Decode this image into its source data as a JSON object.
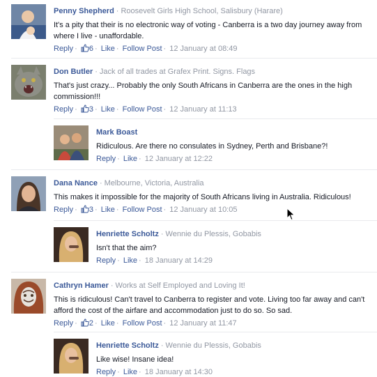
{
  "comments": [
    {
      "author": "Penny Shepherd",
      "headline": "Roosevelt Girls High School, Salisbury (Harare)",
      "text": "It's a pity that their is no electronic way of voting - Canberra is a two day journey away from where I live - unaffordable.",
      "reply_label": "Reply",
      "likes": "6",
      "like_label": "Like",
      "follow_label": "Follow Post",
      "time": "12 January at 08:49"
    },
    {
      "author": "Don Butler",
      "headline": "Jack of all trades at Grafex Print. Signs. Flags",
      "text": "That's just crazy... Probably the only South Africans in Canberra are the ones in the high commission!!!",
      "reply_label": "Reply",
      "likes": "3",
      "like_label": "Like",
      "follow_label": "Follow Post",
      "time": "12 January at 11:13"
    },
    {
      "author": "Mark Boast",
      "text": "Ridiculous. Are there no consulates in Sydney, Perth and Brisbane?!",
      "reply_label": "Reply",
      "like_label": "Like",
      "time": "12 January at 12:22"
    },
    {
      "author": "Dana Nance",
      "headline": "Melbourne, Victoria, Australia",
      "text": "This makes it impossible for the majority of South Africans living in Australia. Ridiculous!",
      "reply_label": "Reply",
      "likes": "3",
      "like_label": "Like",
      "follow_label": "Follow Post",
      "time": "12 January at 10:05"
    },
    {
      "author": "Henriette Scholtz",
      "headline": "Wennie du Plessis, Gobabis",
      "text": "Isn't that the aim?",
      "reply_label": "Reply",
      "like_label": "Like",
      "time": "18 January at 14:29"
    },
    {
      "author": "Cathryn Hamer",
      "headline": "Works at Self Employed and Loving It!",
      "text": "This is ridiculous! Can't travel to Canberra to register and vote. Living too far away and can't afford the cost of the airfare and accommodation just to do so. So sad.",
      "reply_label": "Reply",
      "likes": "2",
      "like_label": "Like",
      "follow_label": "Follow Post",
      "time": "12 January at 11:47"
    },
    {
      "author": "Henriette Scholtz",
      "headline": "Wennie du Plessis, Gobabis",
      "text": "Like wise! Insane idea!",
      "reply_label": "Reply",
      "like_label": "Like",
      "time": "18 January at 14:30"
    }
  ],
  "colors": {
    "link": "#3b5998",
    "muted": "#9197a3",
    "text": "#141823",
    "divider": "#e9eaed"
  },
  "icons": [
    "thumbs-up-icon",
    "mouse-cursor-icon"
  ]
}
